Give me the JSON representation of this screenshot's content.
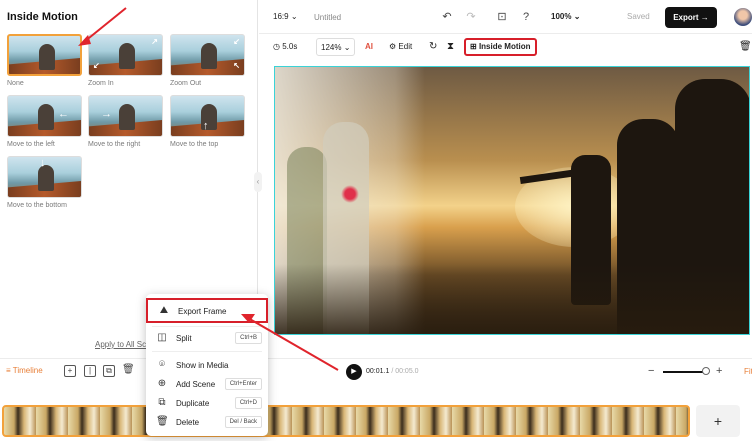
{
  "left_panel": {
    "title": "Inside Motion",
    "presets": [
      {
        "label": "None",
        "arrow": ""
      },
      {
        "label": "Zoom In",
        "arrow": "↙ ↗"
      },
      {
        "label": "Zoom Out",
        "arrow": "↗ ↙"
      },
      {
        "label": "Move to the left",
        "arrow": "←"
      },
      {
        "label": "Move to the right",
        "arrow": "→"
      },
      {
        "label": "Move to the top",
        "arrow": "↑"
      },
      {
        "label": "Move to the bottom",
        "arrow": "↓"
      }
    ],
    "apply_all": "Apply to All Scenes"
  },
  "topbar": {
    "ratio": "16:9",
    "doc_title": "Untitled",
    "zoom": "100%",
    "saved": "Saved",
    "export": "Export"
  },
  "toolbar": {
    "duration": "5.0s",
    "scale": "124%",
    "edit": "Edit",
    "inside_motion": "Inside Motion"
  },
  "playbar": {
    "timeline": "Timeline",
    "current": "00:01.1",
    "total": "/ 00:05.0",
    "fit": "Fit"
  },
  "context_menu": {
    "items": [
      {
        "label": "Export Frame",
        "icon": "export-frame-icon",
        "shortcut": ""
      },
      {
        "label": "Split",
        "icon": "split-icon",
        "shortcut": "Ctrl+B"
      },
      {
        "label": "Show in Media",
        "icon": "location-icon",
        "shortcut": ""
      },
      {
        "label": "Add Scene",
        "icon": "add-icon",
        "shortcut": "Ctrl+Enter"
      },
      {
        "label": "Duplicate",
        "icon": "duplicate-icon",
        "shortcut": "Ctrl+D"
      },
      {
        "label": "Delete",
        "icon": "trash-icon",
        "shortcut": "Del / Back"
      }
    ]
  },
  "colors": {
    "highlight_red": "#d71f2a",
    "accent_orange": "#f2a13b",
    "canvas_border": "#3ad3d7"
  }
}
